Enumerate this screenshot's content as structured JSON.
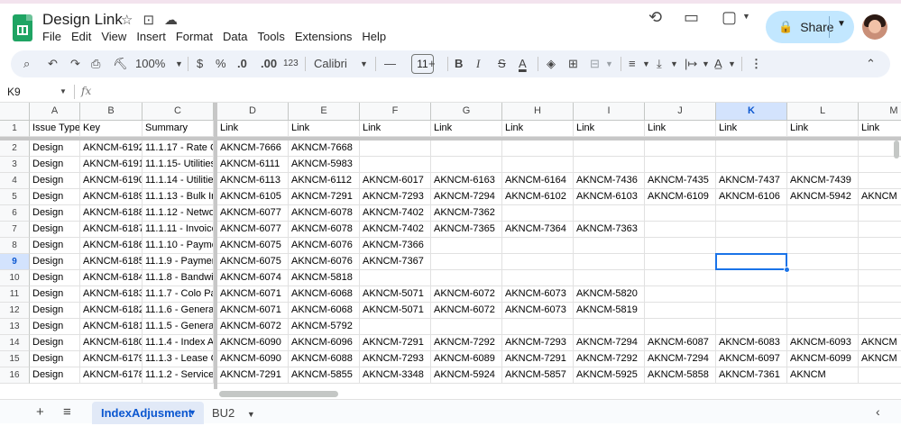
{
  "doc": {
    "title": "Design Link"
  },
  "title_icons": [
    "star-icon",
    "move-to-folder-icon",
    "cloud-status-icon"
  ],
  "menu": [
    "File",
    "Edit",
    "View",
    "Insert",
    "Format",
    "Data",
    "Tools",
    "Extensions",
    "Help"
  ],
  "header": {
    "share_label": "Share"
  },
  "toolbar": {
    "zoom": "100%",
    "currency": "$",
    "percent": "%",
    "dec_less": ".0",
    "dec_more": ".00",
    "number_format": "123",
    "font": "Calibri",
    "font_size": "11",
    "bold": "B",
    "italic": "I",
    "strike": "S",
    "text_color": "A"
  },
  "formula": {
    "cell_ref": "K9",
    "fx": "fx"
  },
  "columns": [
    "A",
    "B",
    "C",
    "D",
    "E",
    "F",
    "G",
    "H",
    "I",
    "J",
    "K",
    "L",
    "M"
  ],
  "rows": [
    [
      "Issue Type",
      "Key",
      "Summary",
      "Link",
      "Link",
      "Link",
      "Link",
      "Link",
      "Link",
      "Link",
      "Link",
      "Link",
      "Link"
    ],
    [
      "Design",
      "AKNCM-6192",
      "11.1.17 - Rate Ca",
      "AKNCM-7666",
      "AKNCM-7668",
      "",
      "",
      "",
      "",
      "",
      "",
      "",
      ""
    ],
    [
      "Design",
      "AKNCM-6191",
      "11.1.15- Utilities",
      "AKNCM-6111",
      "AKNCM-5983",
      "",
      "",
      "",
      "",
      "",
      "",
      "",
      ""
    ],
    [
      "Design",
      "AKNCM-6190",
      "11.1.14 - Utilities",
      "AKNCM-6113",
      "AKNCM-6112",
      "AKNCM-6017",
      "AKNCM-6163",
      "AKNCM-6164",
      "AKNCM-7436",
      "AKNCM-7435",
      "AKNCM-7437",
      "AKNCM-7439",
      ""
    ],
    [
      "Design",
      "AKNCM-6189",
      "11.1.13 - Bulk Inv",
      "AKNCM-6105",
      "AKNCM-7291",
      "AKNCM-7293",
      "AKNCM-7294",
      "AKNCM-6102",
      "AKNCM-6103",
      "AKNCM-6109",
      "AKNCM-6106",
      "AKNCM-5942",
      "AKNCM"
    ],
    [
      "Design",
      "AKNCM-6188",
      "11.1.12 - Networ",
      "AKNCM-6077",
      "AKNCM-6078",
      "AKNCM-7402",
      "AKNCM-7362",
      "",
      "",
      "",
      "",
      "",
      ""
    ],
    [
      "Design",
      "AKNCM-6187",
      "11.1.11 - Invoice",
      "AKNCM-6077",
      "AKNCM-6078",
      "AKNCM-7402",
      "AKNCM-7365",
      "AKNCM-7364",
      "AKNCM-7363",
      "",
      "",
      "",
      ""
    ],
    [
      "Design",
      "AKNCM-6186",
      "11.1.10 - Payme",
      "AKNCM-6075",
      "AKNCM-6076",
      "AKNCM-7366",
      "",
      "",
      "",
      "",
      "",
      "",
      ""
    ],
    [
      "Design",
      "AKNCM-6185",
      "11.1.9 - Payment",
      "AKNCM-6075",
      "AKNCM-6076",
      "AKNCM-7367",
      "",
      "",
      "",
      "",
      "",
      "",
      ""
    ],
    [
      "Design",
      "AKNCM-6184",
      "11.1.8 - Bandwid",
      "AKNCM-6074",
      "AKNCM-5818",
      "",
      "",
      "",
      "",
      "",
      "",
      "",
      ""
    ],
    [
      "Design",
      "AKNCM-6183",
      "11.1.7 - Colo Pay",
      "AKNCM-6071",
      "AKNCM-6068",
      "AKNCM-5071",
      "AKNCM-6072",
      "AKNCM-6073",
      "AKNCM-5820",
      "",
      "",
      "",
      ""
    ],
    [
      "Design",
      "AKNCM-6182",
      "11.1.6 - Generate",
      "AKNCM-6071",
      "AKNCM-6068",
      "AKNCM-5071",
      "AKNCM-6072",
      "AKNCM-6073",
      "AKNCM-5819",
      "",
      "",
      "",
      ""
    ],
    [
      "Design",
      "AKNCM-6181",
      "11.1.5 - Generate",
      "AKNCM-6072",
      "AKNCM-5792",
      "",
      "",
      "",
      "",
      "",
      "",
      "",
      ""
    ],
    [
      "Design",
      "AKNCM-6180",
      "11.1.4 - Index Ac",
      "AKNCM-6090",
      "AKNCM-6096",
      "AKNCM-7291",
      "AKNCM-7292",
      "AKNCM-7293",
      "AKNCM-7294",
      "AKNCM-6087",
      "AKNCM-6083",
      "AKNCM-6093",
      "AKNCM"
    ],
    [
      "Design",
      "AKNCM-6179",
      "11.1.3 - Lease Cla",
      "AKNCM-6090",
      "AKNCM-6088",
      "AKNCM-7293",
      "AKNCM-6089",
      "AKNCM-7291",
      "AKNCM-7292",
      "AKNCM-7294",
      "AKNCM-6097",
      "AKNCM-6099",
      "AKNCM"
    ],
    [
      "Design",
      "AKNCM-6178",
      "11.1.2 - Service C",
      "AKNCM-7291",
      "AKNCM-5855",
      "AKNCM-3348",
      "AKNCM-5924",
      "AKNCM-5857",
      "AKNCM-5925",
      "AKNCM-5858",
      "AKNCM-7361",
      "AKNCM",
      ""
    ]
  ],
  "selection": {
    "cell": "K9",
    "row": 9,
    "column": "K"
  },
  "tabs": [
    {
      "label": "IndexAdjusment",
      "active": true
    },
    {
      "label": "BU2",
      "active": false
    }
  ]
}
